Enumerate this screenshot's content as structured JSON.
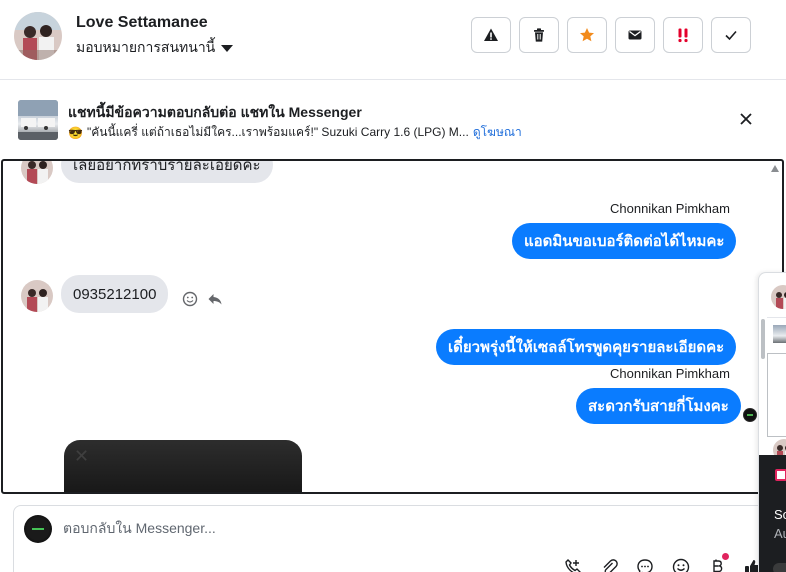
{
  "header": {
    "contact_name": "Love Settamanee",
    "assign_label": "มอบหมายการสนทนานี้",
    "actions": [
      {
        "name": "report-icon",
        "label": "Spam"
      },
      {
        "name": "trash-icon",
        "label": "Delete"
      },
      {
        "name": "star-icon",
        "label": "Star"
      },
      {
        "name": "envelope-icon",
        "label": "Mark unread"
      },
      {
        "name": "follow-up-icon",
        "label": "Follow up"
      },
      {
        "name": "check-icon",
        "label": "Done"
      }
    ]
  },
  "ad": {
    "title": "แชทนี้มีข้อความตอบกลับต่อ แชทใน Messenger",
    "emoji": "😎",
    "snippet": "\"คันนี้แครี่ แต่ถ้าเธอไม่มีใคร...เราพร้อมแคร์!\" Suzuki Carry 1.6 (LPG) M...",
    "link": "ดูโฆษณา"
  },
  "messages": [
    {
      "direction": "in",
      "text": "เลยอยากทราบรายละเอียดคะ"
    },
    {
      "direction": "out",
      "sender": "Chonnikan Pimkham",
      "text": "แอดมินขอเบอร์ติดต่อได้ไหมคะ"
    },
    {
      "direction": "in",
      "text": "0935212100"
    },
    {
      "direction": "out",
      "text": "เดี๋ยวพรุ่งนี้ให้เซลล์โทรพูดคุยรายละเอียดคะ"
    },
    {
      "direction": "out",
      "sender": "Chonnikan Pimkham",
      "text": "สะดวกรับสายกี่โมงคะ"
    }
  ],
  "composer": {
    "placeholder": "ตอบกลับใน Messenger...",
    "tools": [
      "call-add-icon",
      "paperclip-icon",
      "chat-bubble-icon",
      "emoji-icon",
      "bitcoin-icon",
      "thumbs-up-icon"
    ]
  },
  "side_panel": {
    "text_line1": "So",
    "text_line2": "Au"
  },
  "colors": {
    "outgoing_bubble": "#0a7cff",
    "incoming_bubble": "#e4e6eb",
    "star_orange": "#f28b1d",
    "follow_up_red": "#e4002b",
    "link_blue": "#216fdb"
  }
}
